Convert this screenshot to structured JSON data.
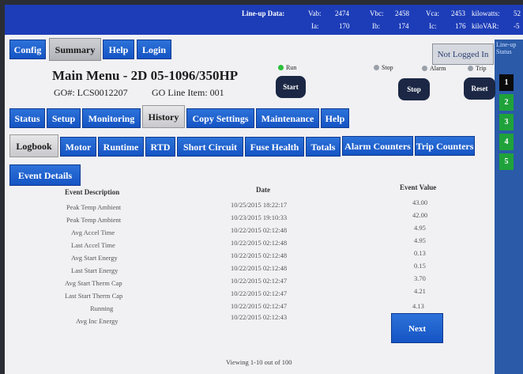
{
  "status_strip": {
    "lineup_label": "Line-up Data:",
    "vab_label": "Vab:",
    "vab_value": "2474",
    "vbc_label": "Vbc:",
    "vbc_value": "2458",
    "vca_label": "Vca:",
    "vca_value": "2453",
    "kw_label": "kilowatts:",
    "kw_value": "52",
    "ia_label": "Ia:",
    "ia_value": "170",
    "ib_label": "Ib:",
    "ib_value": "174",
    "ic_label": "Ic:",
    "ic_value": "176",
    "kvar_label": "kiloVAR:",
    "kvar_value": "-5"
  },
  "top_nav": [
    {
      "label": "Config"
    },
    {
      "label": "Summary"
    },
    {
      "label": "Help"
    },
    {
      "label": "Login"
    }
  ],
  "not_logged_in": "Not Logged In",
  "right_panel": {
    "label": "Line-up Status",
    "items": [
      "1",
      "2",
      "3",
      "4",
      "5"
    ]
  },
  "header": {
    "title": "Main Menu - 2D 05-1096/350HP",
    "go_number": "GO#: LCS0012207",
    "go_line": "GO Line Item: 001"
  },
  "indicators": {
    "run": "Run",
    "stop": "Stop",
    "alarm": "Alarm",
    "trip": "Trip"
  },
  "control_buttons": {
    "start": "Start",
    "stop": "Stop",
    "reset": "Reset"
  },
  "main_tabs": [
    "Status",
    "Setup",
    "Monitoring",
    "History",
    "Copy Settings",
    "Maintenance",
    "Help"
  ],
  "sub_tabs": [
    "Logbook",
    "Motor",
    "Runtime",
    "RTD",
    "Short Circuit",
    "Fuse Health",
    "Totals",
    "Alarm Counters",
    "Trip Counters"
  ],
  "event_tab": "Event Details",
  "table": {
    "headers": [
      "Event Description",
      "Date",
      "Event Value"
    ],
    "rows": [
      {
        "desc": "Peak Temp Ambient",
        "date": "10/25/2015 18:22:17",
        "value": "43.00"
      },
      {
        "desc": "Peak Temp Ambient",
        "date": "10/23/2015 19:10:33",
        "value": "42.00"
      },
      {
        "desc": "Avg Accel Time",
        "date": "10/22/2015 02:12:48",
        "value": "4.95"
      },
      {
        "desc": "Last Accel Time",
        "date": "10/22/2015 02:12:48",
        "value": "4.95"
      },
      {
        "desc": "Avg Start Energy",
        "date": "10/22/2015 02:12:48",
        "value": "0.13"
      },
      {
        "desc": "Last Start Energy",
        "date": "10/22/2015 02:12:48",
        "value": "0.15"
      },
      {
        "desc": "Avg Start Therm Cap",
        "date": "10/22/2015 02:12:47",
        "value": "3.70"
      },
      {
        "desc": "Last Start Therm Cap",
        "date": "10/22/2015 02:12:47",
        "value": "4.21"
      },
      {
        "desc": "Running",
        "date": "10/22/2015 02:12:47",
        "value": ""
      },
      {
        "desc": "Avg Inc Energy",
        "date": "10/22/2015 02:12:43",
        "value": "4.13"
      }
    ]
  },
  "next_button": "Next",
  "viewing": "Viewing 1-10 out of 100",
  "colors": {
    "nav_blue": "#1554c4",
    "run_green": "#2bbf3a",
    "indicator_gray": "#9aa0a8"
  }
}
